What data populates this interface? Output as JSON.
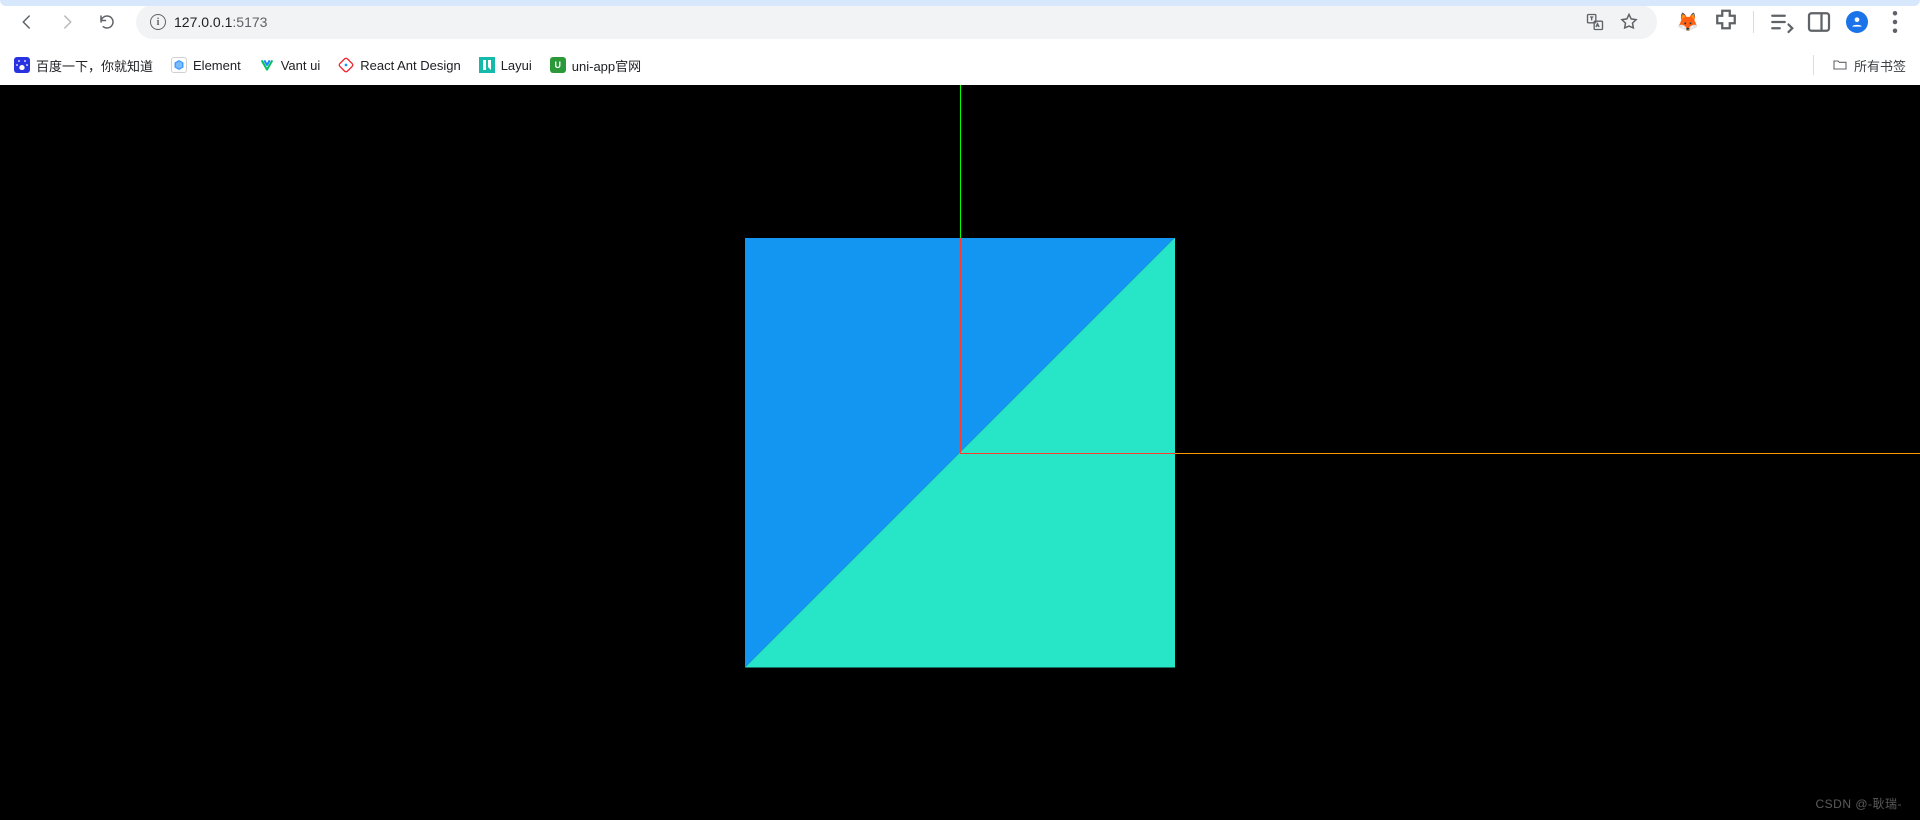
{
  "toolbar": {
    "url_host": "127.0.0.1",
    "url_port": ":5173"
  },
  "bookmarks": {
    "items": [
      {
        "label": "百度一下，你就知道"
      },
      {
        "label": "Element"
      },
      {
        "label": "Vant ui"
      },
      {
        "label": "React Ant Design"
      },
      {
        "label": "Layui"
      },
      {
        "label": "uni-app官网"
      }
    ],
    "all_label": "所有书签"
  },
  "canvas": {
    "axis_y_color": "#00ff00",
    "axis_x_color": "#ff9900",
    "box_axis_color": "#ff3b30",
    "triangle_blue": "#1296f2",
    "triangle_cyan": "#27e6c8",
    "background": "#000000"
  },
  "watermark": "CSDN @-耿瑞-"
}
